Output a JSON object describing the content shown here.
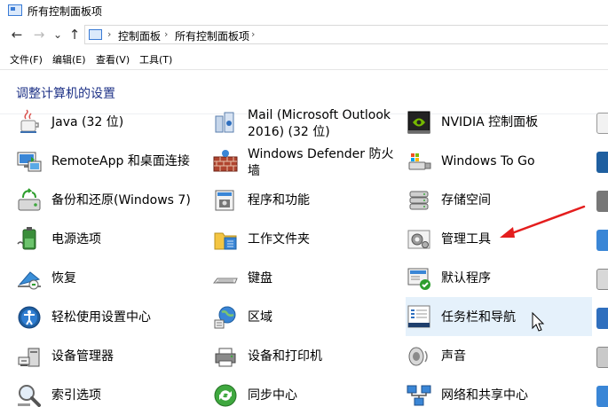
{
  "window": {
    "title": "所有控制面板项"
  },
  "nav": {
    "back": "←",
    "forward": "→",
    "recent": "⌄",
    "up": "↑"
  },
  "address": {
    "sep": "›",
    "crumbs": [
      "控制面板",
      "所有控制面板项"
    ]
  },
  "menu": [
    "文件(F)",
    "编辑(E)",
    "查看(V)",
    "工具(T)"
  ],
  "content": {
    "heading": "调整计算机的设置",
    "items": [
      {
        "id": "java",
        "icon": "java-icon",
        "lines": [
          "Java (32 位)"
        ]
      },
      {
        "id": "mail",
        "icon": "mail-icon",
        "lines": [
          "Mail (Microsoft Outlook",
          "2016) (32 位)"
        ]
      },
      {
        "id": "nvidia",
        "icon": "nvidia-icon",
        "lines": [
          "NVIDIA 控制面板"
        ]
      },
      {
        "id": "remoteapp",
        "icon": "remoteapp-icon",
        "lines": [
          "RemoteApp 和桌面连接"
        ]
      },
      {
        "id": "defender",
        "icon": "firewall-icon",
        "lines": [
          "Windows Defender 防火",
          "墙"
        ]
      },
      {
        "id": "wintogo",
        "icon": "usb-icon",
        "lines": [
          "Windows To Go"
        ]
      },
      {
        "id": "backup",
        "icon": "backup-icon",
        "lines": [
          "备份和还原(Windows 7)"
        ]
      },
      {
        "id": "programs",
        "icon": "programs-icon",
        "lines": [
          "程序和功能"
        ]
      },
      {
        "id": "storage",
        "icon": "storage-icon",
        "lines": [
          "存储空间"
        ]
      },
      {
        "id": "power",
        "icon": "power-icon",
        "lines": [
          "电源选项"
        ]
      },
      {
        "id": "workfolders",
        "icon": "folder-icon",
        "lines": [
          "工作文件夹"
        ]
      },
      {
        "id": "admintools",
        "icon": "admin-tools-icon",
        "lines": [
          "管理工具"
        ]
      },
      {
        "id": "recovery",
        "icon": "recovery-icon",
        "lines": [
          "恢复"
        ]
      },
      {
        "id": "keyboard",
        "icon": "keyboard-icon",
        "lines": [
          "键盘"
        ]
      },
      {
        "id": "defaults",
        "icon": "default-programs-icon",
        "lines": [
          "默认程序"
        ]
      },
      {
        "id": "ease",
        "icon": "ease-of-access-icon",
        "lines": [
          "轻松使用设置中心"
        ]
      },
      {
        "id": "region",
        "icon": "region-icon",
        "lines": [
          "区域"
        ]
      },
      {
        "id": "taskbar",
        "icon": "taskbar-icon",
        "lines": [
          "任务栏和导航"
        ]
      },
      {
        "id": "devmgr",
        "icon": "device-manager-icon",
        "lines": [
          "设备管理器"
        ]
      },
      {
        "id": "printers",
        "icon": "printer-icon",
        "lines": [
          "设备和打印机"
        ]
      },
      {
        "id": "sound",
        "icon": "speaker-icon",
        "lines": [
          "声音"
        ]
      },
      {
        "id": "indexing",
        "icon": "search-icon",
        "lines": [
          "索引选项"
        ]
      },
      {
        "id": "sync",
        "icon": "sync-icon",
        "lines": [
          "同步中心"
        ]
      },
      {
        "id": "network",
        "icon": "network-icon",
        "lines": [
          "网络和共享中心"
        ]
      }
    ]
  },
  "colors": {
    "heading": "#1e3287",
    "hover": "#e5f1fb",
    "arrow": "#e41e1e"
  }
}
